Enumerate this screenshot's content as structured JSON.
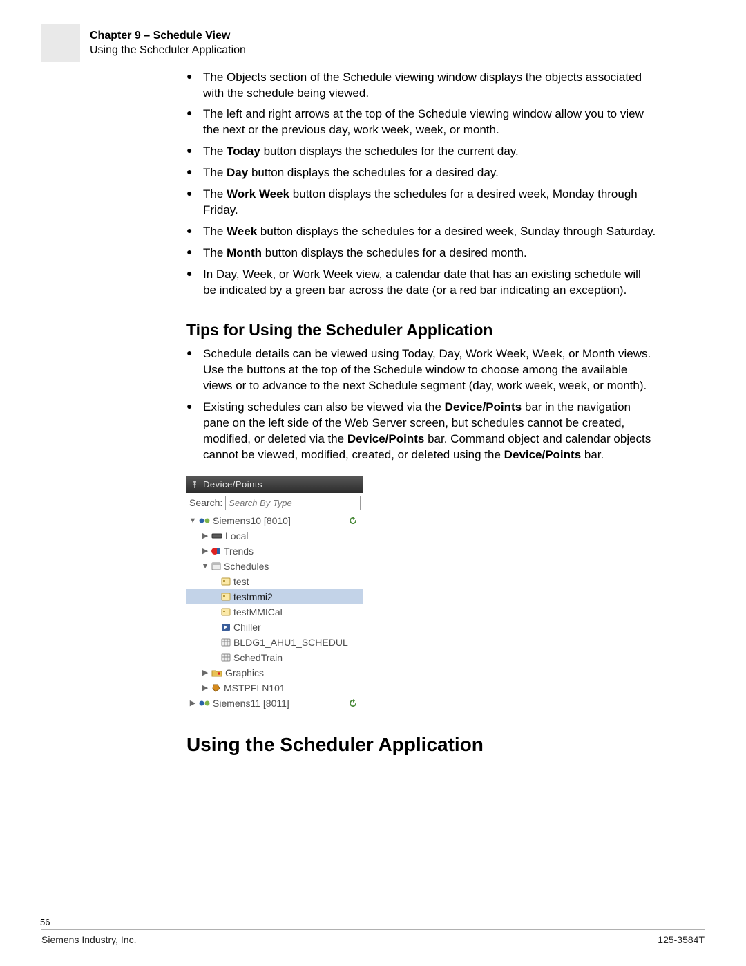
{
  "header": {
    "chapter": "Chapter 9 – Schedule View",
    "subtitle": "Using the Scheduler Application"
  },
  "bullets1": [
    {
      "pre": "The Objects section of the Schedule viewing window displays the objects associated with the schedule being viewed."
    },
    {
      "pre": "The left and right arrows at the top of the Schedule viewing window allow you to view the next or the previous day, work week, week, or month."
    },
    {
      "pre": "The ",
      "b1": "Today",
      "post1": " button displays the schedules for the current day."
    },
    {
      "pre": "The ",
      "b1": "Day",
      "post1": " button displays the schedules for a desired day."
    },
    {
      "pre": "The ",
      "b1": "Work Week",
      "post1": " button displays the schedules for a desired week, Monday through Friday."
    },
    {
      "pre": "The ",
      "b1": "Week",
      "post1": " button displays the schedules for a desired week, Sunday through Saturday."
    },
    {
      "pre": "The ",
      "b1": "Month",
      "post1": " button displays the schedules for a desired month."
    },
    {
      "pre": "In Day, Week, or Work Week view, a calendar date that has an existing schedule will be indicated by a green bar across the date (or a red bar indicating an exception)."
    }
  ],
  "headings": {
    "tips": "Tips for Using the Scheduler Application",
    "using": "Using the Scheduler Application"
  },
  "bullets2": [
    {
      "pre": "Schedule details can be viewed using Today, Day, Work Week, Week, or Month views. Use the buttons at the top of the Schedule window to choose among the available views or to advance to the next Schedule segment (day, work week, week, or month)."
    },
    {
      "pre": "Existing schedules can also be viewed via the ",
      "b1": "Device/Points",
      "post1": " bar in the navigation pane on the left side of the Web Server screen, but schedules cannot be created, modified, or deleted via the ",
      "b2": "Device/Points",
      "post2": " bar. Command object and calendar objects cannot be viewed, modified, created, or deleted using the ",
      "b3": "Device/Points",
      "post3": " bar."
    }
  ],
  "panel": {
    "title": "Device/Points",
    "search_label": "Search:",
    "search_placeholder": "Search By Type",
    "rows": {
      "siemens10": "Siemens10 [8010]",
      "local": "Local",
      "trends": "Trends",
      "schedules": "Schedules",
      "test": "test",
      "testmmi2": "testmmi2",
      "testmmical": "testMMICal",
      "chiller": "Chiller",
      "bldg": "BLDG1_AHU1_SCHEDUL",
      "schedtrain": "SchedTrain",
      "graphics": "Graphics",
      "mstp": "MSTPFLN101",
      "siemens11": "Siemens11 [8011]"
    }
  },
  "footer": {
    "page": "56",
    "left": "Siemens Industry, Inc.",
    "right": "125-3584T"
  }
}
